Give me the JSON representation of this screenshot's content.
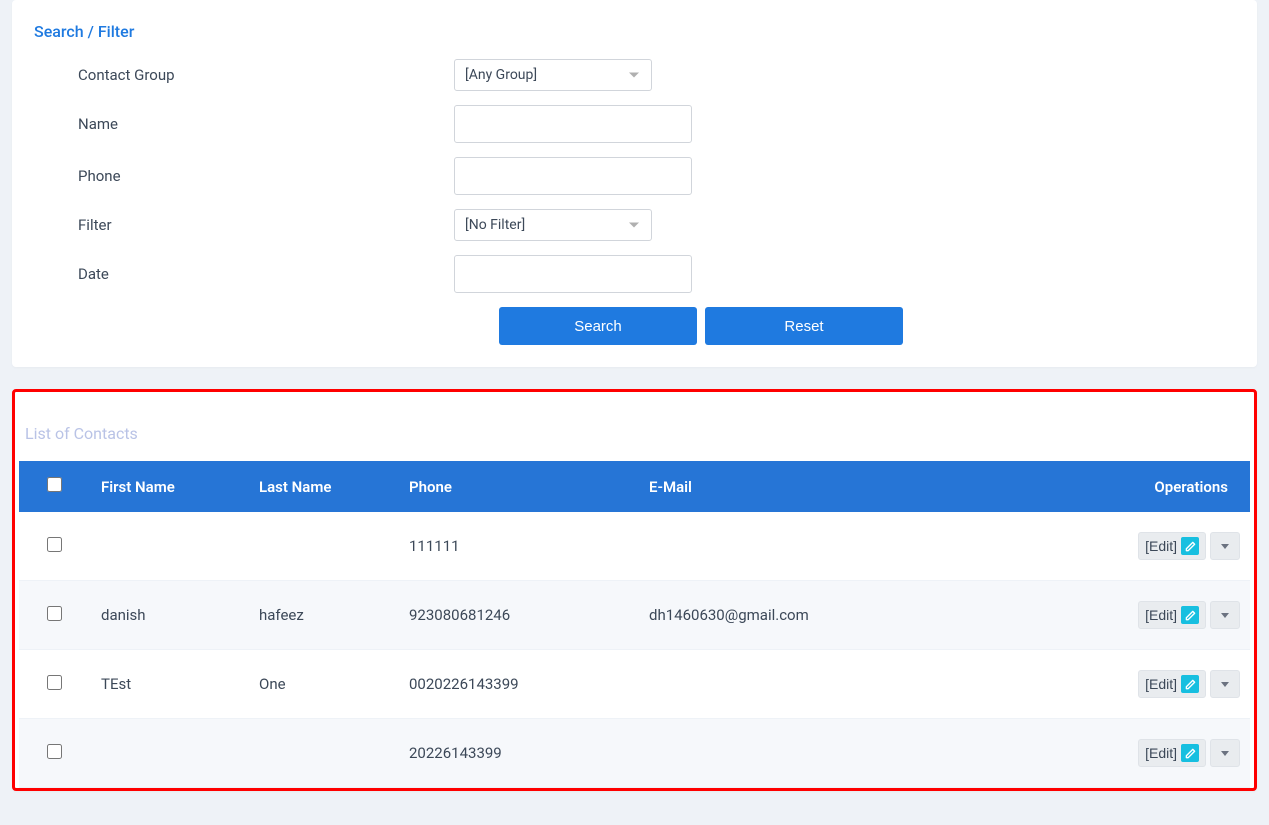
{
  "filterCard": {
    "title": "Search / Filter",
    "labels": {
      "contact_group": "Contact Group",
      "name": "Name",
      "phone": "Phone",
      "filter": "Filter",
      "date": "Date"
    },
    "group_select": "[Any Group]",
    "filter_select": "[No Filter]",
    "name_value": "",
    "phone_value": "",
    "date_value": "",
    "buttons": {
      "search": "Search",
      "reset": "Reset"
    }
  },
  "contactsCard": {
    "title": "List of Contacts",
    "headers": {
      "first_name": "First Name",
      "last_name": "Last Name",
      "phone": "Phone",
      "email": "E-Mail",
      "operations": "Operations"
    },
    "edit_label": "[Edit]",
    "rows": [
      {
        "first_name": "",
        "last_name": "",
        "phone": "111111",
        "email": ""
      },
      {
        "first_name": "danish",
        "last_name": "hafeez",
        "phone": "923080681246",
        "email": "dh1460630@gmail.com"
      },
      {
        "first_name": "TEst",
        "last_name": "One",
        "phone": "0020226143399",
        "email": ""
      },
      {
        "first_name": "",
        "last_name": "",
        "phone": "20226143399",
        "email": ""
      }
    ]
  }
}
